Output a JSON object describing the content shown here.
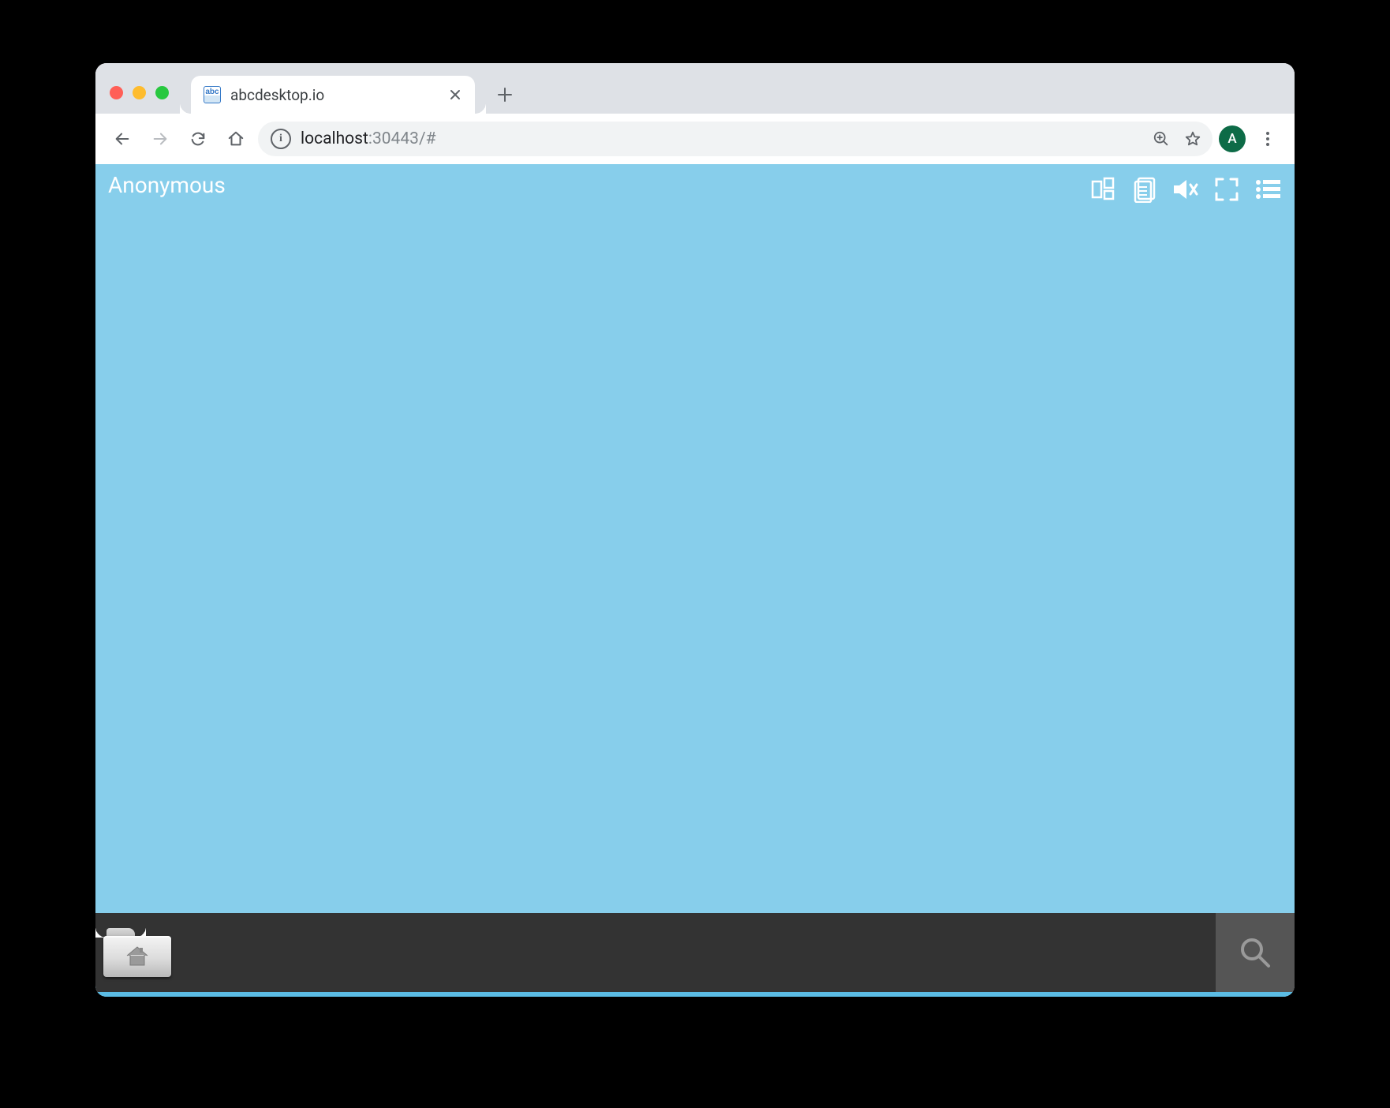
{
  "browser": {
    "tab": {
      "title": "abcdesktop.io",
      "favicon_text": "abc"
    },
    "url": {
      "host": "localhost",
      "rest": ":30443/#"
    },
    "avatar_initial": "A"
  },
  "desktop": {
    "user_label": "Anonymous",
    "colors": {
      "background": "#87ceeb",
      "topbar_text": "#ffffff",
      "taskbar": "#333333",
      "taskbar_search": "#555555",
      "bottom_accent": "#5bbce4"
    }
  }
}
